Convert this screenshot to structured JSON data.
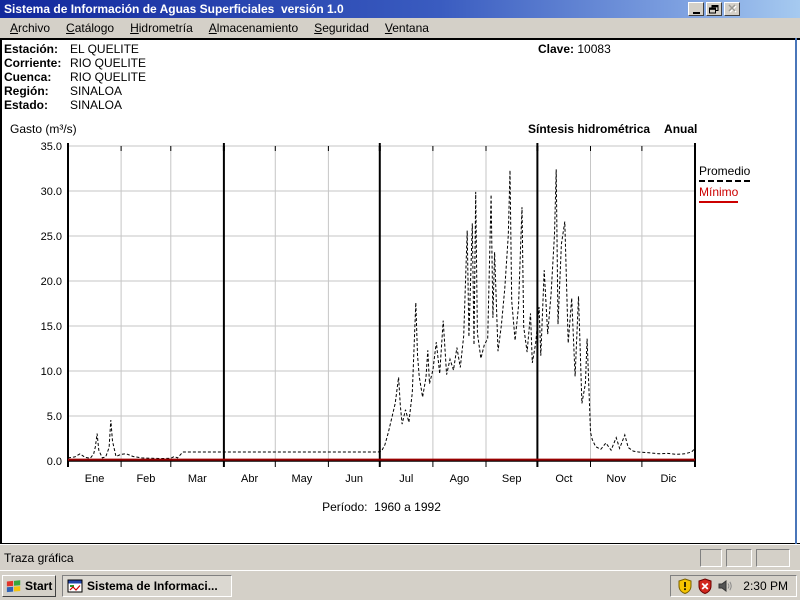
{
  "window": {
    "title": "Sistema de Información de Aguas Superficiales  versión 1.0"
  },
  "menu": {
    "items": [
      {
        "key": "A",
        "rest": "rchivo"
      },
      {
        "key": "C",
        "rest": "atálogo"
      },
      {
        "key": "H",
        "rest": "idrometría"
      },
      {
        "key": "A",
        "rest": "lmacenamiento"
      },
      {
        "key": "S",
        "rest": "eguridad"
      },
      {
        "key": "V",
        "rest": "entana"
      }
    ]
  },
  "station_info": {
    "rows": [
      {
        "label": "Estación:",
        "value": "EL QUELITE"
      },
      {
        "label": "Corriente:",
        "value": "RIO QUELITE"
      },
      {
        "label": "Cuenca:",
        "value": "RIO QUELITE"
      },
      {
        "label": "Región:",
        "value": "SINALOA"
      },
      {
        "label": "Estado:",
        "value": "SINALOA"
      }
    ],
    "clave_label": "Clave:",
    "clave_value": "10083"
  },
  "chart_header": {
    "ylabel": "Gasto (m³/s)",
    "title": "Síntesis hidrométrica",
    "subtitle": "Anual"
  },
  "legend": {
    "promedio": "Promedio",
    "minimo": "Mínimo"
  },
  "period_caption": "Período:  1960 a 1992",
  "status_bar": {
    "text": "Traza gráfica"
  },
  "taskbar": {
    "start_label": "Start",
    "task_label": "Sistema de Informaci...",
    "clock": "2:30 PM",
    "tray_icons": [
      "security-alert-shield",
      "security-error-shield",
      "volume"
    ]
  },
  "chart_data": {
    "type": "line",
    "title": "Síntesis hidrométrica Anual",
    "ylabel": "Gasto (m³/s)",
    "period": "1960 a 1992",
    "ylim": [
      0,
      35
    ],
    "yticks": [
      "0.0",
      "5.0",
      "10.0",
      "15.0",
      "20.0",
      "25.0",
      "30.0",
      "35.0"
    ],
    "x_months": [
      "Ene",
      "Feb",
      "Mar",
      "Abr",
      "May",
      "Jun",
      "Jul",
      "Ago",
      "Sep",
      "Oct",
      "Nov",
      "Dic"
    ],
    "x_days_total": 366,
    "month_start_days": [
      0,
      31,
      60,
      91,
      121,
      152,
      182,
      213,
      244,
      274,
      305,
      335,
      366
    ],
    "quarter_boundaries_days": [
      0,
      91,
      182,
      274,
      366
    ],
    "grid": true,
    "grid_color": "#c6c6c6",
    "legend_position": "right-top-outside",
    "series": [
      {
        "id": "promedio",
        "name": "Promedio",
        "style": "dashed",
        "color": "#000000",
        "width": 1,
        "points": [
          [
            0,
            0.35
          ],
          [
            4,
            0.45
          ],
          [
            7,
            0.8
          ],
          [
            10,
            0.4
          ],
          [
            13,
            0.3
          ],
          [
            15,
            0.8
          ],
          [
            16,
            1.6
          ],
          [
            17,
            3.05
          ],
          [
            18,
            1.2
          ],
          [
            20,
            0.35
          ],
          [
            22,
            0.45
          ],
          [
            24,
            1.5
          ],
          [
            25,
            4.55
          ],
          [
            26,
            2.2
          ],
          [
            28,
            0.5
          ],
          [
            31,
            0.75
          ],
          [
            34,
            0.8
          ],
          [
            38,
            0.5
          ],
          [
            43,
            0.35
          ],
          [
            49,
            0.3
          ],
          [
            55,
            0.28
          ],
          [
            60,
            0.3
          ],
          [
            62,
            0.5
          ],
          [
            64,
            0.35
          ],
          [
            67,
            1.0
          ],
          [
            95,
            1.0
          ],
          [
            125,
            1.0
          ],
          [
            155,
            1.0
          ],
          [
            181,
            1.0
          ],
          [
            183,
            1.1
          ],
          [
            185,
            1.8
          ],
          [
            187,
            3.2
          ],
          [
            189,
            4.8
          ],
          [
            191,
            6.4
          ],
          [
            193,
            9.3
          ],
          [
            194,
            6.2
          ],
          [
            195,
            4.1
          ],
          [
            197,
            5.7
          ],
          [
            199,
            4.3
          ],
          [
            201,
            7.6
          ],
          [
            203,
            17.6
          ],
          [
            204,
            11.8
          ],
          [
            205,
            9.4
          ],
          [
            207,
            7.1
          ],
          [
            209,
            9.3
          ],
          [
            210,
            12.3
          ],
          [
            211,
            8.6
          ],
          [
            213,
            10.1
          ],
          [
            215,
            13.2
          ],
          [
            217,
            9.7
          ],
          [
            219,
            15.6
          ],
          [
            221,
            9.6
          ],
          [
            223,
            11.3
          ],
          [
            225,
            10.1
          ],
          [
            227,
            12.6
          ],
          [
            229,
            10.4
          ],
          [
            231,
            13.9
          ],
          [
            233,
            25.6
          ],
          [
            234,
            13.8
          ],
          [
            236,
            26.4
          ],
          [
            237,
            12.9
          ],
          [
            238,
            29.9
          ],
          [
            239,
            14.2
          ],
          [
            241,
            11.4
          ],
          [
            243,
            12.9
          ],
          [
            245,
            13.6
          ],
          [
            247,
            29.6
          ],
          [
            248,
            15.9
          ],
          [
            249,
            23.2
          ],
          [
            251,
            12.2
          ],
          [
            253,
            15.1
          ],
          [
            255,
            19.2
          ],
          [
            257,
            25.1
          ],
          [
            258,
            32.3
          ],
          [
            259,
            17.8
          ],
          [
            261,
            13.4
          ],
          [
            263,
            17.2
          ],
          [
            265,
            28.2
          ],
          [
            266,
            14.9
          ],
          [
            268,
            12.1
          ],
          [
            270,
            16.4
          ],
          [
            271,
            10.9
          ],
          [
            273,
            13.1
          ],
          [
            275,
            17.1
          ],
          [
            276,
            11.7
          ],
          [
            278,
            21.2
          ],
          [
            280,
            14.1
          ],
          [
            282,
            18.6
          ],
          [
            284,
            25.2
          ],
          [
            285,
            32.4
          ],
          [
            286,
            15.2
          ],
          [
            288,
            24.1
          ],
          [
            290,
            26.6
          ],
          [
            292,
            13.1
          ],
          [
            294,
            18.1
          ],
          [
            296,
            9.4
          ],
          [
            298,
            18.3
          ],
          [
            300,
            6.4
          ],
          [
            302,
            8.6
          ],
          [
            303,
            13.6
          ],
          [
            305,
            3.2
          ],
          [
            306,
            2.4
          ],
          [
            308,
            1.6
          ],
          [
            311,
            1.3
          ],
          [
            314,
            2.0
          ],
          [
            317,
            1.2
          ],
          [
            320,
            2.6
          ],
          [
            322,
            1.4
          ],
          [
            325,
            2.9
          ],
          [
            327,
            1.5
          ],
          [
            330,
            1.1
          ],
          [
            333,
            1.0
          ],
          [
            336,
            0.95
          ],
          [
            340,
            0.9
          ],
          [
            345,
            0.8
          ],
          [
            350,
            0.85
          ],
          [
            355,
            0.75
          ],
          [
            360,
            0.8
          ],
          [
            364,
            1.0
          ],
          [
            366,
            1.4
          ]
        ]
      },
      {
        "id": "minimo",
        "name": "Mínimo",
        "style": "solid",
        "color": "#990000",
        "width": 2,
        "points": [
          [
            0,
            0.15
          ],
          [
            366,
            0.15
          ]
        ]
      }
    ]
  }
}
